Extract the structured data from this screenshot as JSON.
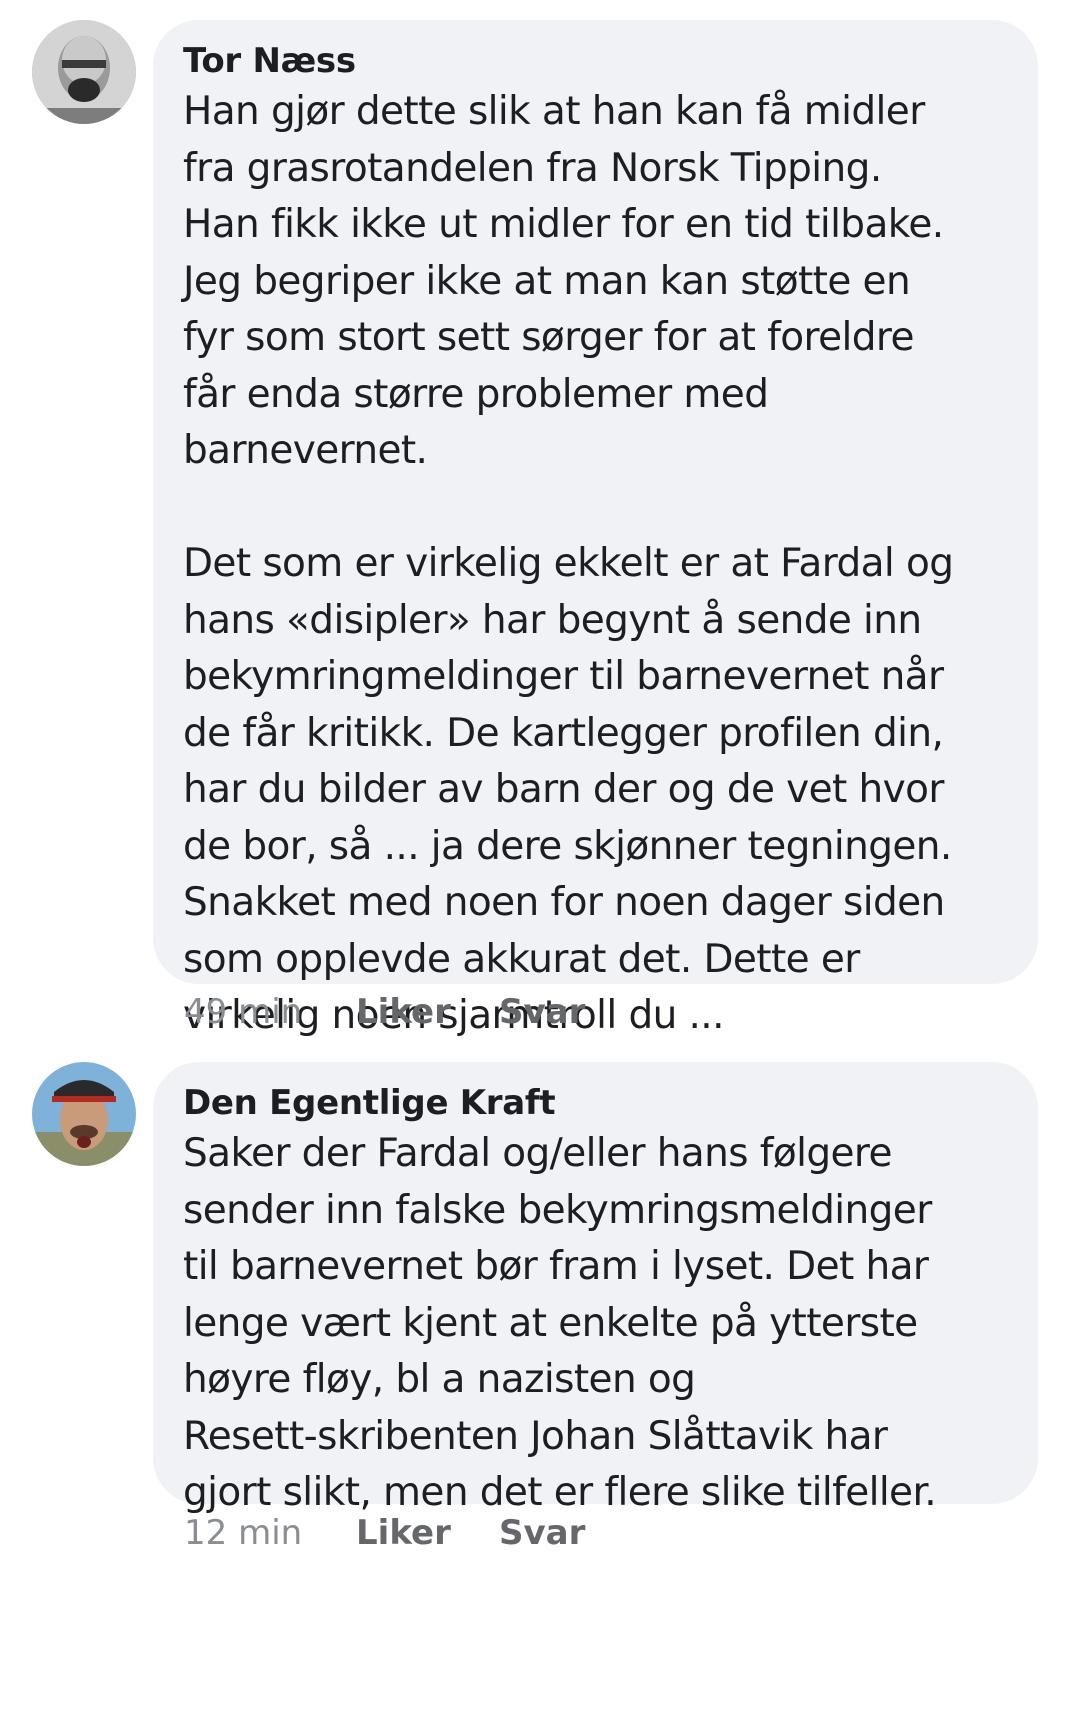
{
  "comments": [
    {
      "author": "Tor Næss",
      "text": "Han gjør dette slik at han kan få midler\nfra grasrotandelen fra Norsk Tipping.\nHan fikk ikke ut midler for en tid tilbake.\nJeg begriper ikke at man kan støtte en\nfyr som stort sett sørger for at foreldre\nfår enda større problemer med\nbarnevernet.\n\nDet som er virkelig ekkelt er at Fardal og\nhans «disipler» har begynt å sende inn\nbekymringmeldinger til barnevernet når\nde får kritikk. De kartlegger profilen din,\nhar du bilder av barn der og de vet hvor\nde bor, så ... ja dere skjønner tegningen.\nSnakket med noen for noen dager siden\nsom opplevde akkurat det. Dette er\nvirkelig noen sjarmtroll du ...",
      "time": "49 min",
      "like_label": "Liker",
      "reply_label": "Svar"
    },
    {
      "author": "Den Egentlige Kraft",
      "text": "Saker der Fardal og/eller hans følgere\nsender inn falske bekymringsmeldinger\ntil barnevernet bør fram i lyset. Det har\nlenge vært kjent at enkelte på ytterste\nhøyre fløy, bl a nazisten og\nResett-skribenten Johan Slåttavik har\ngjort slikt, men det er flere slike tilfeller.",
      "time": "12 min",
      "like_label": "Liker",
      "reply_label": "Svar"
    }
  ]
}
